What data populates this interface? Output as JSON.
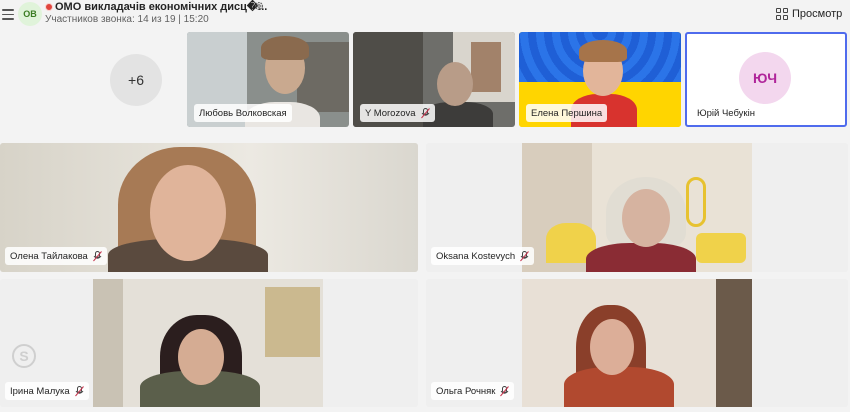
{
  "header": {
    "avatar_initials": "ОВ",
    "title": "ОМО викладачів економічних дисц�...",
    "subtitle": "Участников звонка: 14 из 19 | 15:20",
    "view_label": "Просмотр"
  },
  "overflow_count": "+6",
  "top_row": [
    {
      "name": "Любовь Волковская",
      "muted": false
    },
    {
      "name": "Y Morozova",
      "muted": true
    },
    {
      "name": "Елена Першина",
      "muted": false
    },
    {
      "name": "Юрій Чебукін",
      "muted": false,
      "initials": "ЮЧ"
    }
  ],
  "main_grid": [
    {
      "name": "Олена Тайлакова",
      "muted": true
    },
    {
      "name": "Oksana Kostevych",
      "muted": true
    },
    {
      "name": "Ірина Малука",
      "muted": true
    },
    {
      "name": "Ольга Рочняк",
      "muted": true
    }
  ],
  "colors": {
    "recording": "#e0453d",
    "active_speaker_border": "#4f6bed",
    "avatar_bg": "#f3d7ee",
    "avatar_text": "#b0259a"
  }
}
